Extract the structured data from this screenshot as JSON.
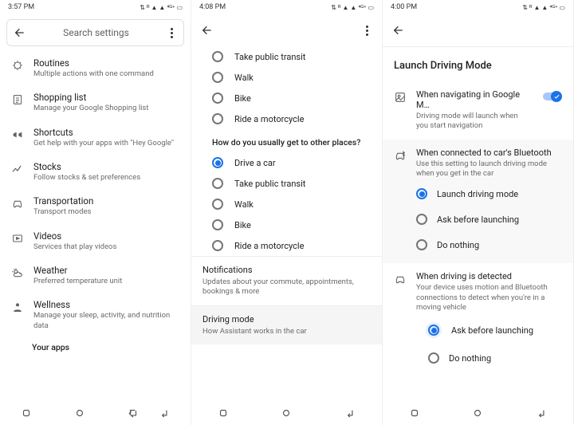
{
  "screen1": {
    "time": "3:57 PM",
    "search_placeholder": "Search settings",
    "items": [
      {
        "title": "Routines",
        "sub": "Multiple actions with one command"
      },
      {
        "title": "Shopping list",
        "sub": "Manage your Google Shopping list"
      },
      {
        "title": "Shortcuts",
        "sub": "Get help with your apps with \"Hey Google\""
      },
      {
        "title": "Stocks",
        "sub": "Follow stocks & set preferences"
      },
      {
        "title": "Transportation",
        "sub": "Transport modes"
      },
      {
        "title": "Videos",
        "sub": "Services that play videos"
      },
      {
        "title": "Weather",
        "sub": "Preferred temperature unit"
      },
      {
        "title": "Wellness",
        "sub": "Manage your sleep, activity, and nutrition data"
      }
    ],
    "section_label": "Your apps"
  },
  "screen2": {
    "time": "4:08 PM",
    "group1": {
      "options": [
        "Take public transit",
        "Walk",
        "Bike",
        "Ride a motorcycle"
      ]
    },
    "group2": {
      "question": "How do you usually get to other places?",
      "options": [
        "Drive a car",
        "Take public transit",
        "Walk",
        "Bike",
        "Ride a motorcycle"
      ],
      "selected": 0
    },
    "notifications": {
      "title": "Notifications",
      "sub": "Updates about your commute, appointments, bookings & more"
    },
    "driving": {
      "title": "Driving mode",
      "sub": "How Assistant works in the car"
    }
  },
  "screen3": {
    "time": "4:00 PM",
    "header": "Launch Driving Mode",
    "opt1": {
      "title": "When navigating in Google M…",
      "sub": "Driving mode will launch when you start navigation",
      "toggled": true
    },
    "opt2": {
      "title": "When connected to car's Bluetooth",
      "sub": "Use this setting to launch driving mode when you get in the car",
      "radios": [
        "Launch driving mode",
        "Ask before launching",
        "Do nothing"
      ],
      "selected": 0
    },
    "opt3": {
      "title": "When driving is detected",
      "sub": "Your device uses motion and Bluetooth connections to detect when you're in a moving vehicle",
      "radios": [
        "Ask before launching",
        "Do nothing"
      ],
      "selected": 0
    }
  },
  "status_icons": "⇅ ⏰ 📶 📶 ⁴ᴳ⁺ 🔋"
}
